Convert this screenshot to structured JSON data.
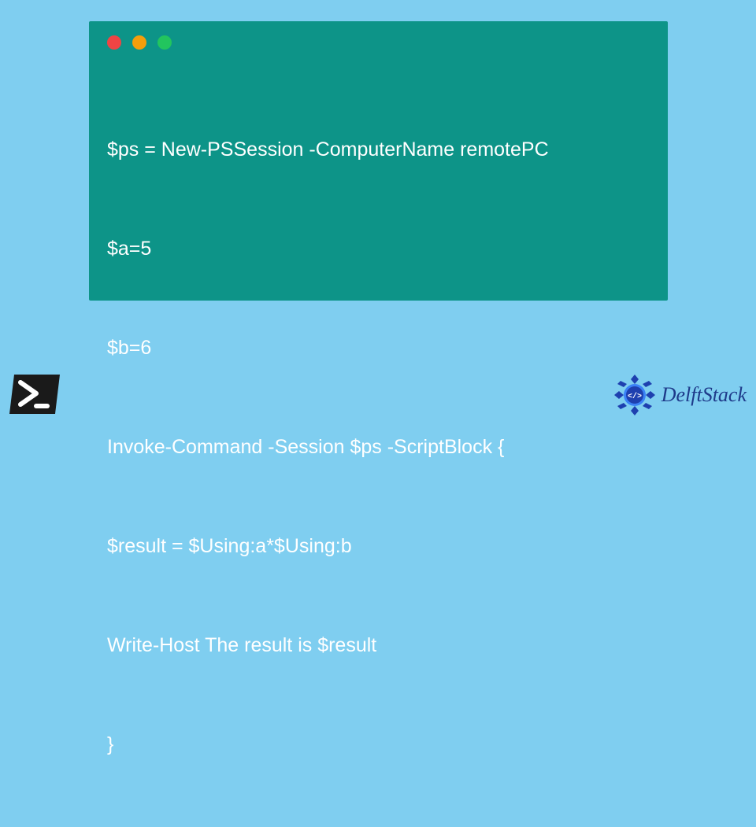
{
  "code": {
    "lines": [
      "$ps = New-PSSession -ComputerName remotePC",
      "$a=5",
      "$b=6",
      "Invoke-Command -Session $ps -ScriptBlock {",
      "$result = $Using:a*$Using:b",
      "Write-Host The result is $result",
      "}"
    ]
  },
  "brand": {
    "name": "DelftStack"
  },
  "colors": {
    "background": "#7fcef0",
    "window": "#0d9488",
    "text": "#ffffff",
    "brand": "#1e3a8a"
  }
}
